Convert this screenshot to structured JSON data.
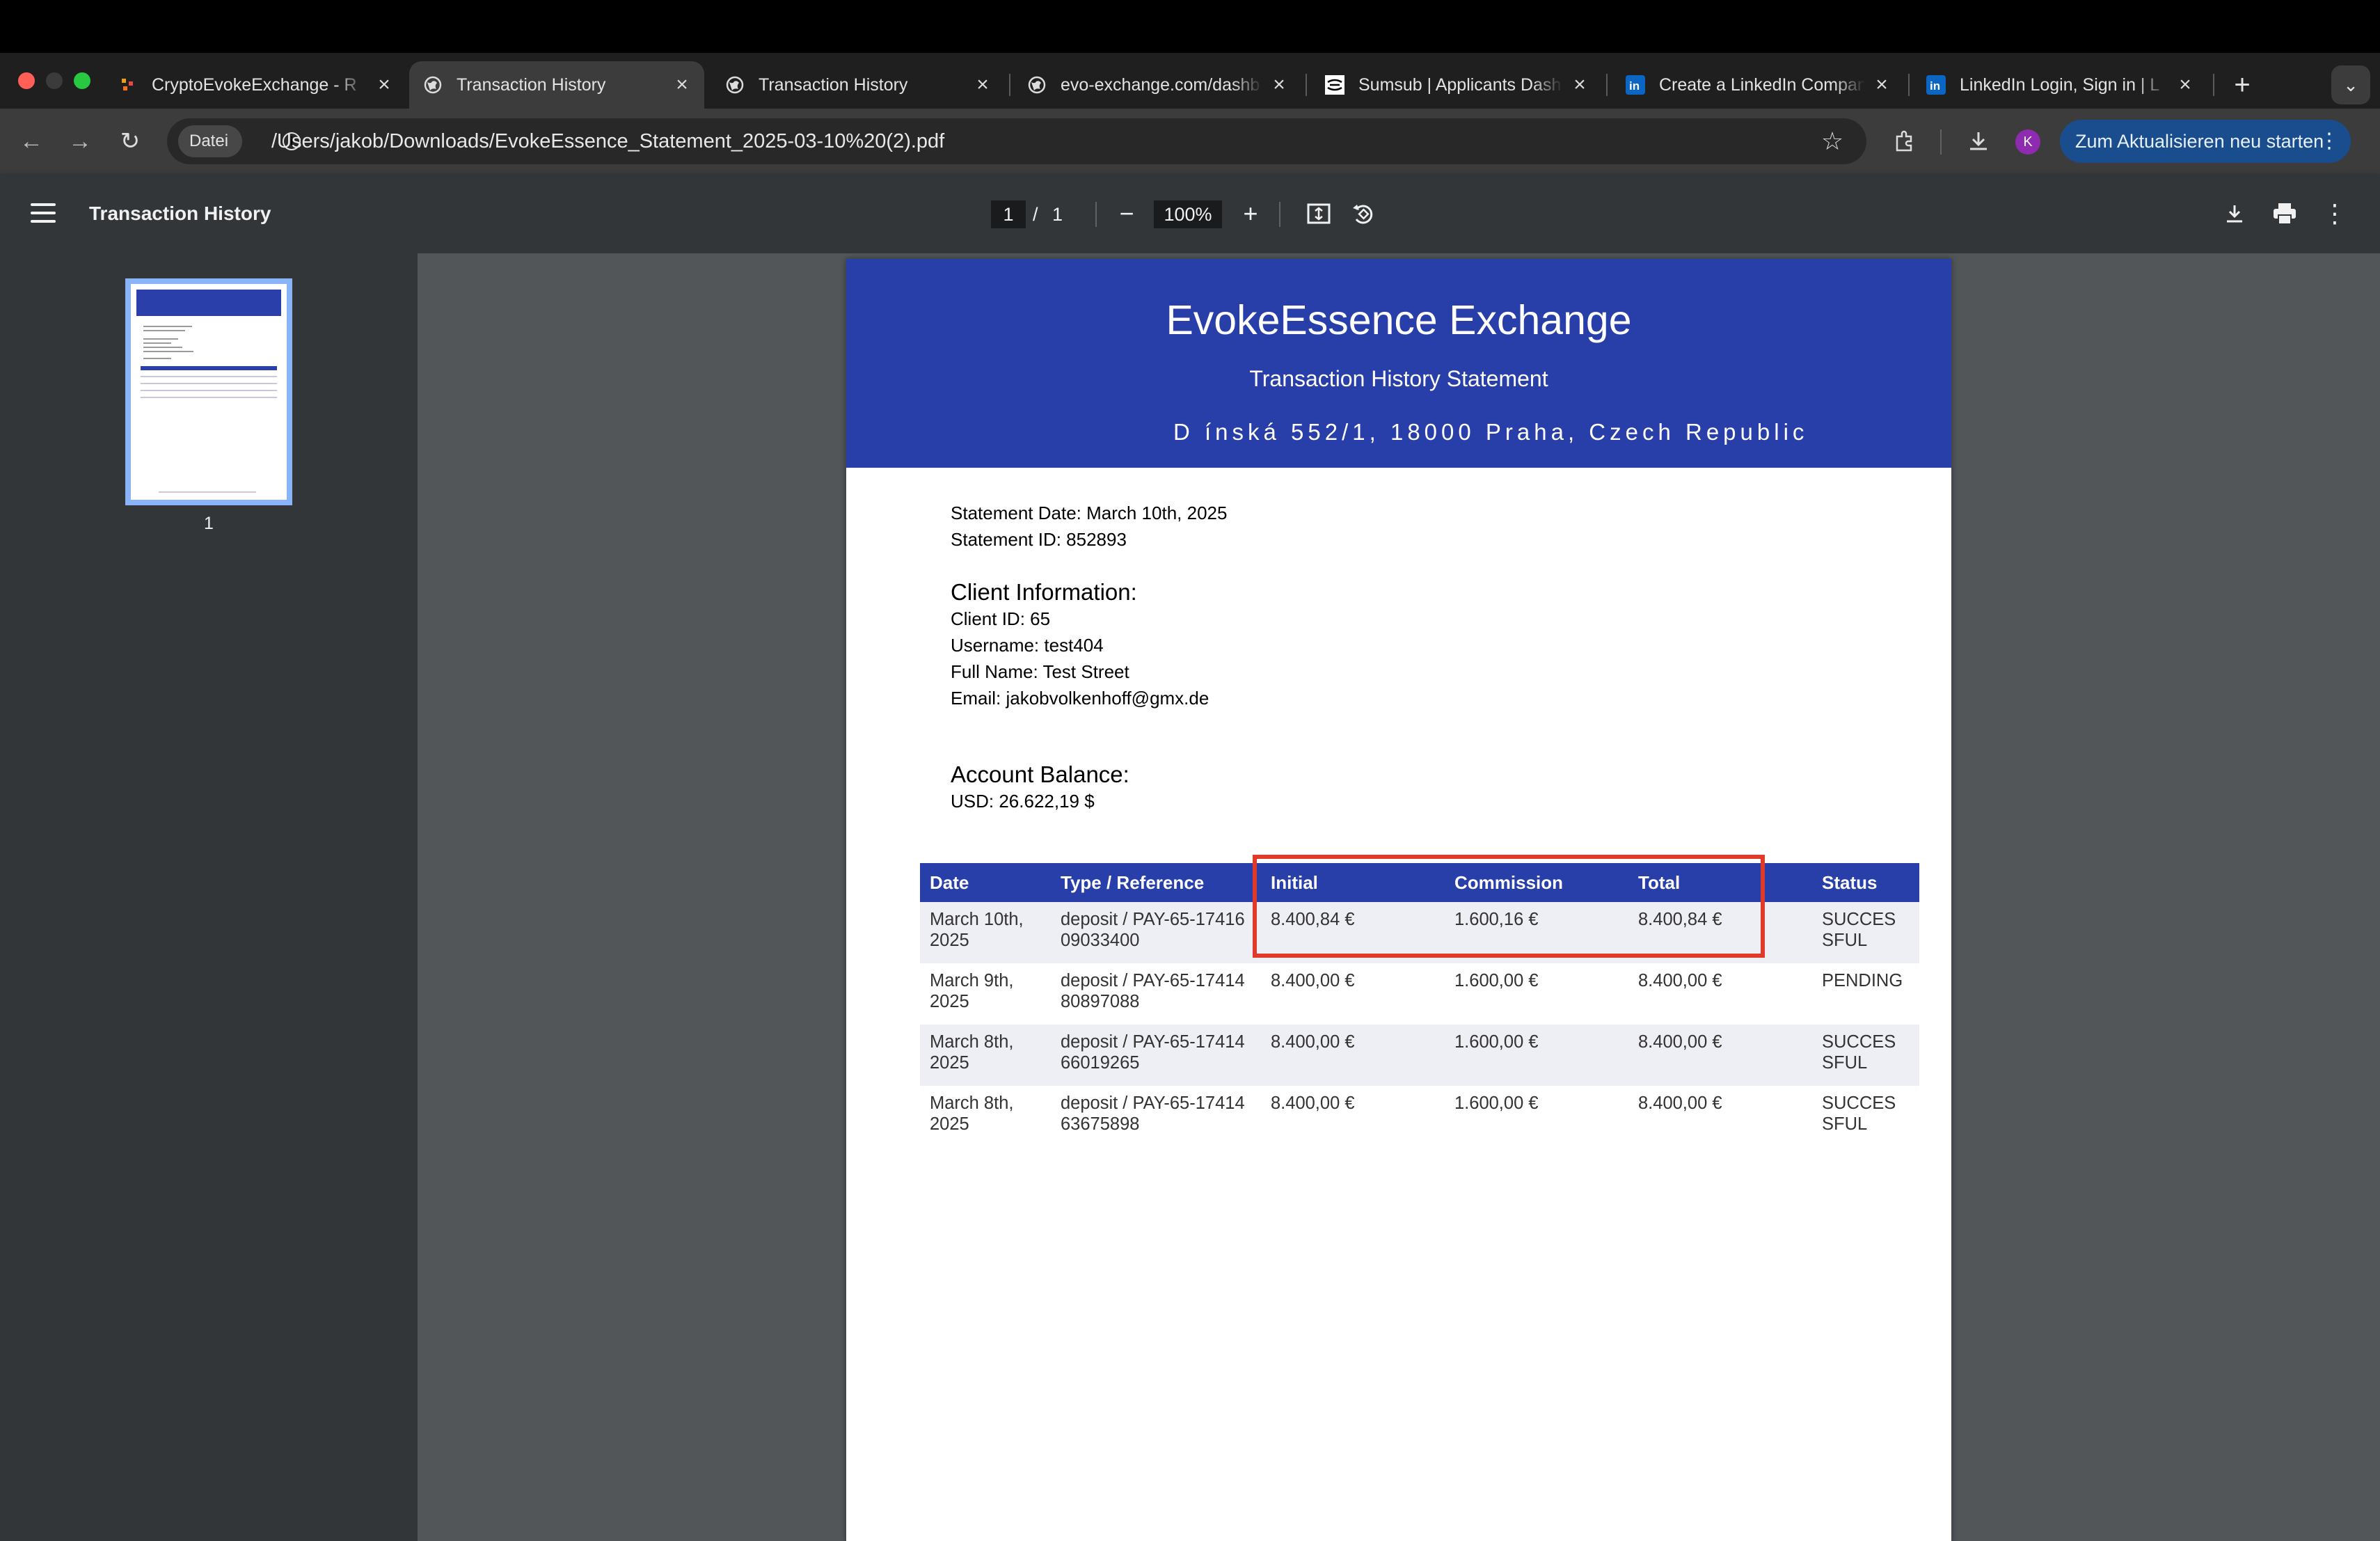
{
  "browser": {
    "tabs": [
      {
        "title": "CryptoEvokeExchange - R",
        "favicon": "app-icon"
      },
      {
        "title": "Transaction History",
        "favicon": "globe-icon",
        "active": true
      },
      {
        "title": "Transaction History",
        "favicon": "globe-icon"
      },
      {
        "title": "evo-exchange.com/dashb",
        "favicon": "globe-icon"
      },
      {
        "title": "Sumsub | Applicants Dash",
        "favicon": "sumsub-icon"
      },
      {
        "title": "Create a LinkedIn Compan",
        "favicon": "linkedin-icon"
      },
      {
        "title": "LinkedIn Login, Sign in | L",
        "favicon": "linkedin-icon"
      }
    ],
    "address": {
      "chip_label": "Datei",
      "url": "/Users/jakob/Downloads/EvokeEssence_Statement_2025-03-10%20(2).pdf"
    },
    "profile_initial": "K",
    "update_button": "Zum Aktualisieren neu starten"
  },
  "viewer": {
    "title": "Transaction History",
    "page_current": "1",
    "page_separator": "/",
    "page_total": "1",
    "zoom": "100%",
    "thumbnail_label": "1"
  },
  "document": {
    "company": "EvokeEssence Exchange",
    "title": "Transaction History Statement",
    "address": "D  ínská 552/1, 18000 Praha, Czech Republic",
    "statement_date": "Statement Date: March 10th, 2025",
    "statement_id": "Statement ID: 852893",
    "client_heading": "Client Information:",
    "client_id": "Client ID: 65",
    "username": "Username: test404",
    "full_name": "Full Name: Test Street",
    "email": "Email: jakobvolkenhoff@gmx.de",
    "balance_heading": "Account Balance:",
    "balance": "USD: 26.622,19 $",
    "table": {
      "headers": [
        "Date",
        "Type / Reference",
        "Initial",
        "Commission",
        "Total",
        "Status"
      ],
      "rows": [
        {
          "date1": "March 10th,",
          "date2": "2025",
          "ref1": "deposit / PAY-65-17416",
          "ref2": "09033400",
          "initial": "8.400,84 €",
          "commission": "1.600,16 €",
          "total": "8.400,84 €",
          "status1": "SUCCES",
          "status2": "SFUL"
        },
        {
          "date1": "March 9th,",
          "date2": "2025",
          "ref1": "deposit / PAY-65-17414",
          "ref2": "80897088",
          "initial": "8.400,00 €",
          "commission": "1.600,00 €",
          "total": "8.400,00 €",
          "status1": "PENDING",
          "status2": ""
        },
        {
          "date1": "March 8th,",
          "date2": "2025",
          "ref1": "deposit / PAY-65-17414",
          "ref2": "66019265",
          "initial": "8.400,00 €",
          "commission": "1.600,00 €",
          "total": "8.400,00 €",
          "status1": "SUCCES",
          "status2": "SFUL"
        },
        {
          "date1": "March 8th,",
          "date2": "2025",
          "ref1": "deposit / PAY-65-17414",
          "ref2": "63675898",
          "initial": "8.400,00 €",
          "commission": "1.600,00 €",
          "total": "8.400,00 €",
          "status1": "SUCCES",
          "status2": "SFUL"
        }
      ]
    }
  },
  "colors": {
    "banner": "#283ea9",
    "highlight": "#e03a2a",
    "update_button": "#194d8d"
  }
}
